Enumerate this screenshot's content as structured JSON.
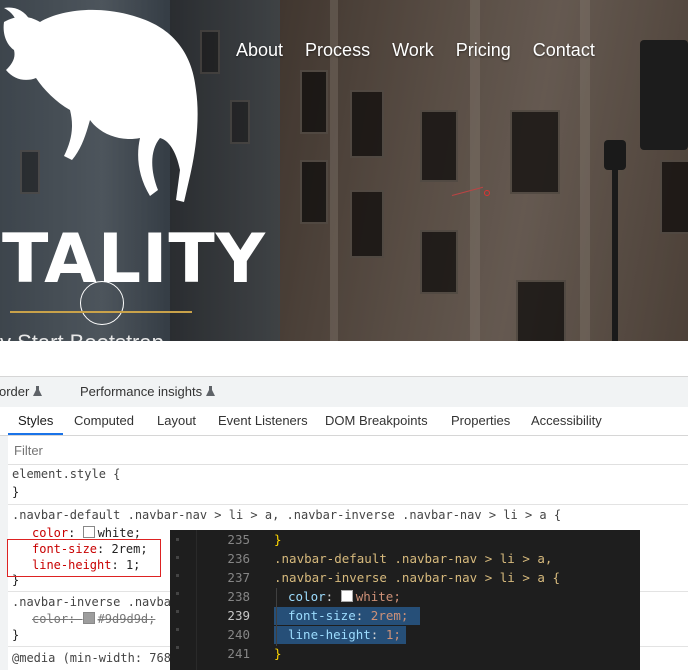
{
  "hero": {
    "nav": [
      "About",
      "Process",
      "Work",
      "Pricing",
      "Contact"
    ],
    "brand_text": "TALITY",
    "tagline": "y Start Bootstrap"
  },
  "devtools": {
    "top_tabs": [
      "order",
      "Performance insights"
    ],
    "panel_tabs": [
      "Styles",
      "Computed",
      "Layout",
      "Event Listeners",
      "DOM Breakpoints",
      "Properties",
      "Accessibility"
    ],
    "active_tab": "Styles",
    "filter_placeholder": "Filter",
    "rules": {
      "element_style": {
        "selector": "element.style {",
        "close": "}"
      },
      "rule1": {
        "selector": ".navbar-default .navbar-nav > li > a, .navbar-inverse .navbar-nav > li > a {",
        "decls": [
          {
            "prop": "color",
            "value": "white;"
          },
          {
            "prop": "font-size",
            "value": "2rem;"
          },
          {
            "prop": "line-height",
            "value": "1;"
          }
        ],
        "close": "}"
      },
      "rule2": {
        "selector": ".navbar-inverse .navba",
        "decls": [
          {
            "prop": "color",
            "value": "#9d9d9d;"
          }
        ],
        "close": "}"
      },
      "media": {
        "text": "@media (min-width: 768"
      }
    },
    "colors": {
      "swatch_white": "#ffffff",
      "swatch_gray": "#9d9d9d"
    }
  },
  "editor": {
    "lines": [
      {
        "num": "235",
        "text": "}"
      },
      {
        "num": "236",
        "text": ".navbar-default .navbar-nav > li > a,"
      },
      {
        "num": "237",
        "text": ".navbar-inverse .navbar-nav > li > a {"
      },
      {
        "num": "238",
        "prop": "color",
        "value": "white;"
      },
      {
        "num": "239",
        "prop": "font-size",
        "value": "2rem;"
      },
      {
        "num": "240",
        "prop": "line-height",
        "value": "1;"
      },
      {
        "num": "241",
        "text": "}"
      }
    ]
  }
}
